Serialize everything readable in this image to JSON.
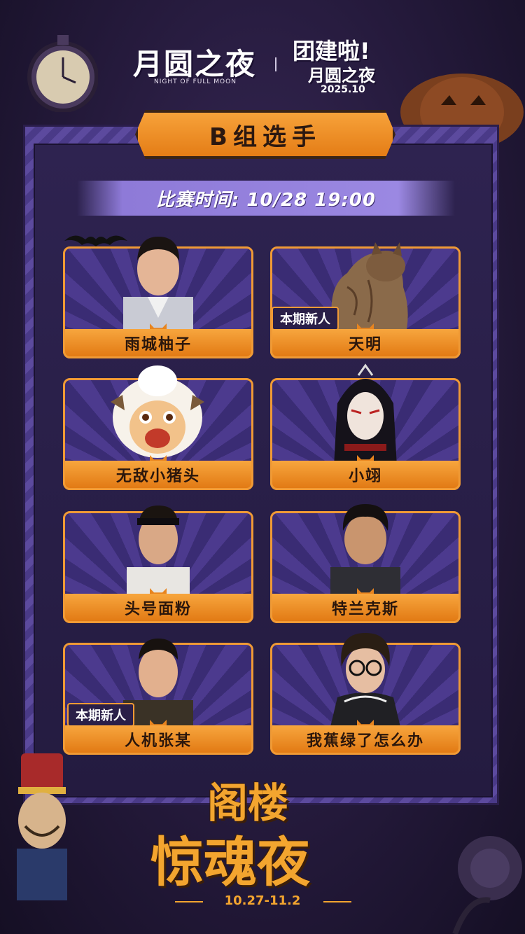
{
  "header": {
    "logo_main": "月圆之夜",
    "logo_sub": "NIGHT OF FULL MOON",
    "event_title": "团建啦!",
    "event_sub": "月圆之夜",
    "event_date": "2025.10"
  },
  "banner": {
    "title": "B组选手"
  },
  "schedule": {
    "time": "比赛时间: 10/28 19:00"
  },
  "players": [
    {
      "name": "雨城柚子",
      "badge": ""
    },
    {
      "name": "天明",
      "badge": "本期新人"
    },
    {
      "name": "无敌小猪头",
      "badge": ""
    },
    {
      "name": "小翊",
      "badge": ""
    },
    {
      "name": "头号面粉",
      "badge": ""
    },
    {
      "name": "特兰克斯",
      "badge": ""
    },
    {
      "name": "人机张某",
      "badge": "本期新人"
    },
    {
      "name": "我蕉绿了怎么办",
      "badge": ""
    }
  ],
  "footer": {
    "title_line1": "阁楼",
    "title_line2": "惊魂夜",
    "dates": "10.27-11.2"
  },
  "colors": {
    "accent": "#f09a35",
    "frame": "#5c4a9e",
    "background": "#251a3c"
  }
}
